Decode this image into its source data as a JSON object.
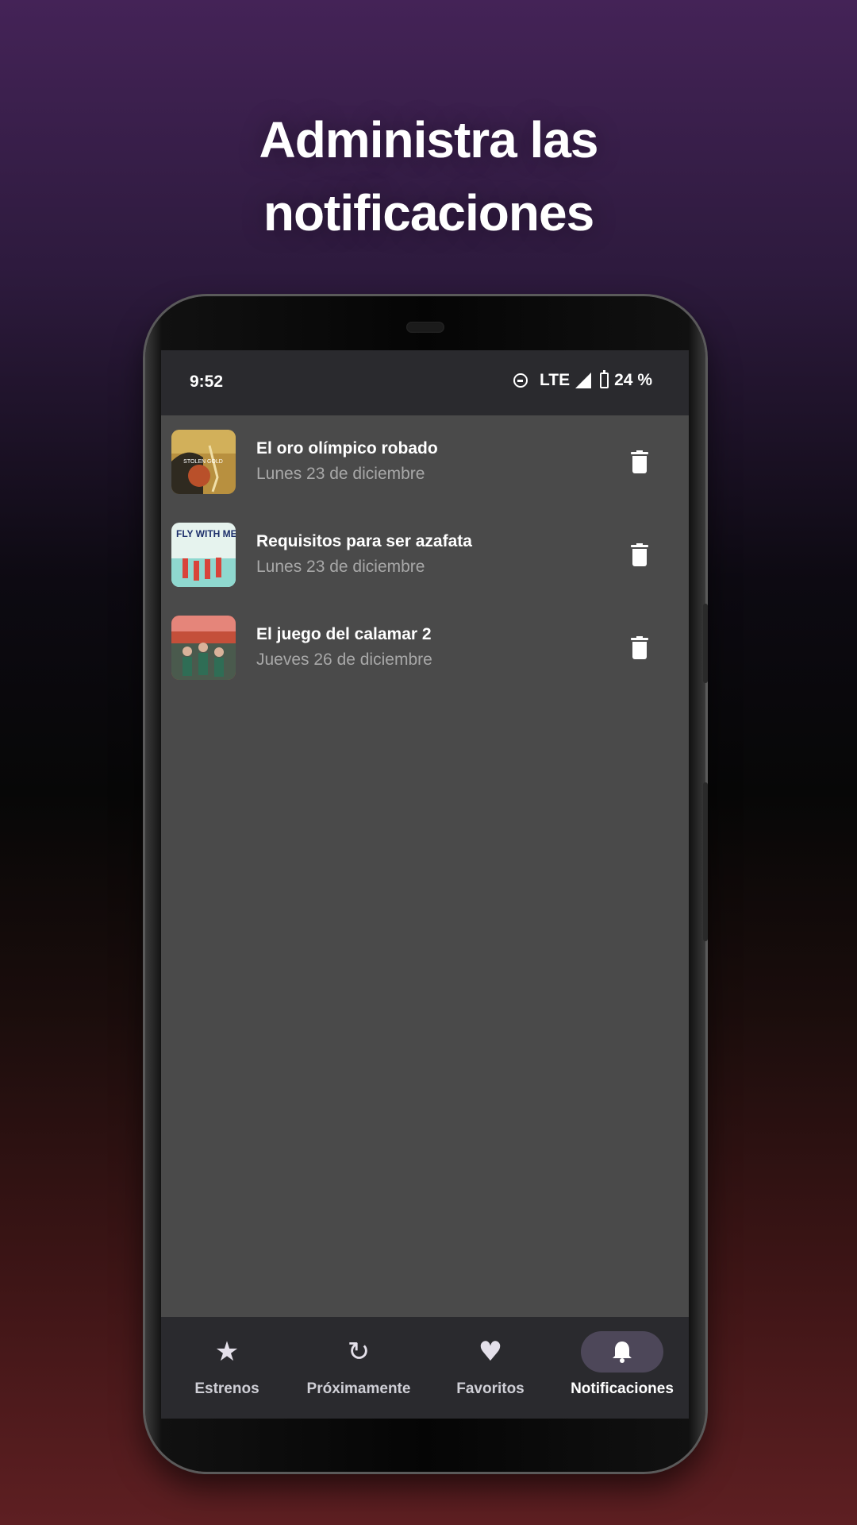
{
  "headline": {
    "line1": "Administra las",
    "line2": "notificaciones"
  },
  "status_bar": {
    "time": "9:52",
    "network": "LTE",
    "battery": "24 %"
  },
  "notifications": [
    {
      "title": "El oro olímpico robado",
      "date": "Lunes 23 de diciembre",
      "thumb_text": "STOLEN GOLD",
      "thumb_colors": [
        "#c9a24a",
        "#4a3b1e"
      ]
    },
    {
      "title": "Requisitos para ser azafata",
      "date": "Lunes 23 de diciembre",
      "thumb_text": "FLY WITH ME",
      "thumb_colors": [
        "#9fe0d9",
        "#e8f5ef"
      ]
    },
    {
      "title": "El juego del calamar 2",
      "date": "Jueves 26 de diciembre",
      "thumb_text": "",
      "thumb_colors": [
        "#c9533c",
        "#3b5a4a"
      ]
    }
  ],
  "nav": {
    "items": [
      {
        "label": "Estrenos",
        "icon": "star-icon"
      },
      {
        "label": "Próximamente",
        "icon": "refresh-icon"
      },
      {
        "label": "Favoritos",
        "icon": "heart-icon"
      },
      {
        "label": "Notificaciones",
        "icon": "bell-icon"
      }
    ],
    "active": "Notificaciones"
  }
}
